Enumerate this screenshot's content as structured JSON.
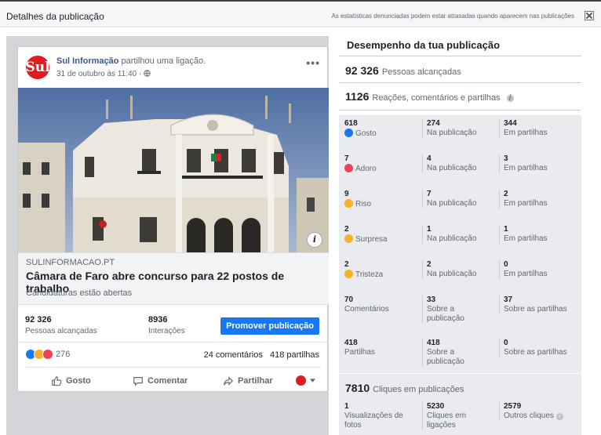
{
  "topbar": {
    "title": "Detalhes da publicação",
    "note": "As estatísticas denunciadas podem estar atrasadas quando aparecem nas publicações"
  },
  "post": {
    "avatar_text": "Sul",
    "page_name": "Sul Informação",
    "action": " partilhou uma ligação.",
    "date": "31 de outubro às 11:40 · ",
    "more": "•••",
    "link": {
      "domain": "SULINFORMACAO.PT",
      "headline": "Câmara de Faro abre concurso para 22 postos de trabalho",
      "description": "Candidaturas estão abertas"
    },
    "stats": {
      "reach_value": "92 326",
      "reach_label": "Pessoas alcançadas",
      "interactions_value": "8936",
      "interactions_label": "Interações",
      "promote_label": "Promover publicação"
    },
    "reactions_count": "276",
    "comments": "24 comentários",
    "shares": "418 partilhas",
    "actions": {
      "like": "Gosto",
      "comment": "Comentar",
      "share": "Partilhar"
    }
  },
  "performance": {
    "title": "Desempenho da tua publicação",
    "reach_value": "92 326",
    "reach_label": "Pessoas alcançadas",
    "engagement_value": "1126",
    "engagement_label": "Reações, comentários e partilhas",
    "rows": [
      {
        "total": "618",
        "label": "Gosto",
        "on_post": "274",
        "on_post_label": "Na publicação",
        "on_shares": "344",
        "on_shares_label": "Em partilhas"
      },
      {
        "total": "7",
        "label": "Adoro",
        "on_post": "4",
        "on_post_label": "Na publicação",
        "on_shares": "3",
        "on_shares_label": "Em partilhas"
      },
      {
        "total": "9",
        "label": "Riso",
        "on_post": "7",
        "on_post_label": "Na publicação",
        "on_shares": "2",
        "on_shares_label": "Em partilhas"
      },
      {
        "total": "2",
        "label": "Surpresa",
        "on_post": "1",
        "on_post_label": "Na publicação",
        "on_shares": "1",
        "on_shares_label": "Em partilhas"
      },
      {
        "total": "2",
        "label": "Tristeza",
        "on_post": "2",
        "on_post_label": "Na publicação",
        "on_shares": "0",
        "on_shares_label": "Em partilhas"
      },
      {
        "total": "70",
        "label": "Comentários",
        "on_post": "33",
        "on_post_label": "Sobre a publicação",
        "on_shares": "37",
        "on_shares_label": "Sobre as partilhas"
      },
      {
        "total": "418",
        "label": "Partilhas",
        "on_post": "418",
        "on_post_label": "Sobre a publicação",
        "on_shares": "0",
        "on_shares_label": "Sobre as partilhas"
      }
    ],
    "clicks_value": "7810",
    "clicks_label": "Cliques em publicações",
    "clicks": [
      {
        "value": "1",
        "label": "Visualizações de fotos"
      },
      {
        "value": "5230",
        "label": "Cliques em ligações"
      },
      {
        "value": "2579",
        "label": "Outros cliques"
      }
    ]
  },
  "colors": {
    "facebook_blue": "#1877f2",
    "brand_red": "#e11b22",
    "link_blue": "#385898"
  }
}
